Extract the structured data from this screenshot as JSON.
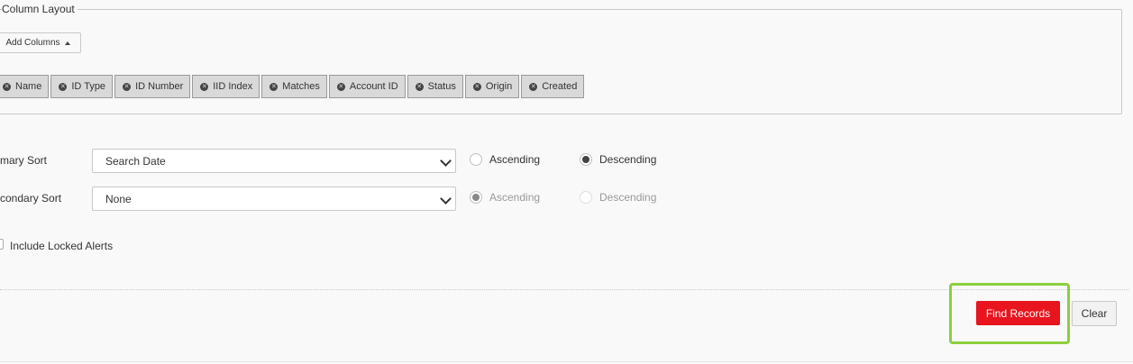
{
  "column_layout": {
    "legend": "Column Layout",
    "add_columns_label": "Add Columns",
    "columns": [
      "Name",
      "ID Type",
      "ID Number",
      "IID Index",
      "Matches",
      "Account ID",
      "Status",
      "Origin",
      "Created"
    ]
  },
  "primary_sort": {
    "label": "mary Sort",
    "selected": "Search Date",
    "ascending_label": "Ascending",
    "descending_label": "Descending",
    "order": "Descending"
  },
  "secondary_sort": {
    "label": "condary Sort",
    "selected": "None",
    "ascending_label": "Ascending",
    "descending_label": "Descending",
    "order": "Ascending",
    "disabled": true
  },
  "include_locked": {
    "label": "Include Locked Alerts",
    "checked": false
  },
  "actions": {
    "find_label": "Find Records",
    "clear_label": "Clear"
  },
  "colors": {
    "find_button": "#e8141e",
    "highlight": "#8ccf3e"
  }
}
